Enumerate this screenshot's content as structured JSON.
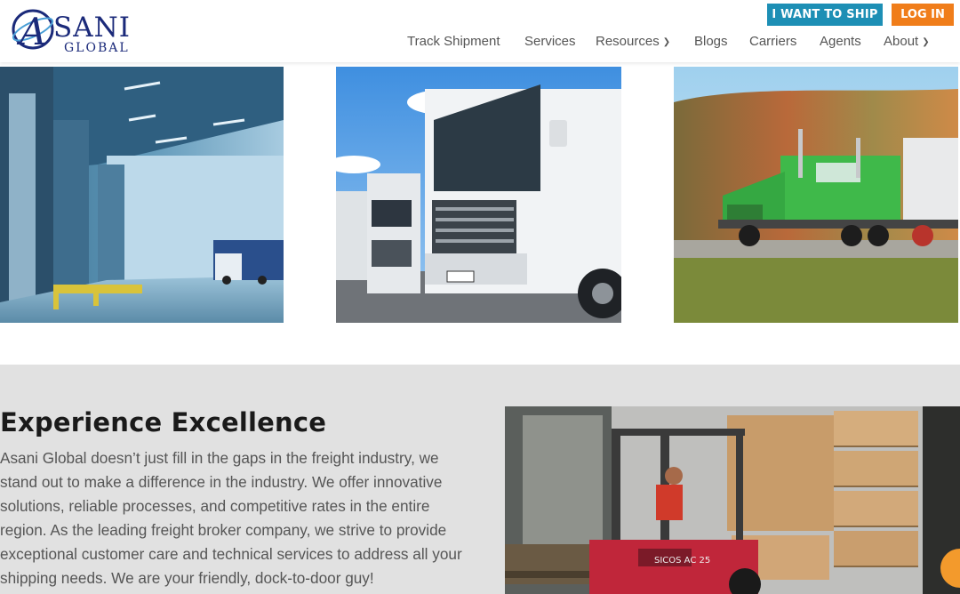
{
  "logo": {
    "text": "SANI",
    "mark_letter": "A",
    "subtitle": "GLOBAL"
  },
  "header": {
    "ship_button": "I WANT TO SHIP",
    "login_button": "LOG IN",
    "colors": {
      "ship": "#1d8fb5",
      "login": "#f07d1a",
      "logo": "#1b2a7a"
    }
  },
  "nav": {
    "items": [
      {
        "label": "Track Shipment",
        "dropdown": false
      },
      {
        "label": "Services",
        "dropdown": false
      },
      {
        "label": "Resources",
        "dropdown": true
      },
      {
        "label": "Blogs",
        "dropdown": false
      },
      {
        "label": "Carriers",
        "dropdown": false
      },
      {
        "label": "Agents",
        "dropdown": false
      },
      {
        "label": "About",
        "dropdown": true
      }
    ],
    "chevron_icon": "chevron-down-icon"
  },
  "photos": [
    {
      "subject": "warehouse loading dock"
    },
    {
      "subject": "row of white trucks"
    },
    {
      "subject": "green semi truck on road"
    }
  ],
  "section": {
    "title": "Experience Excellence",
    "body": "Asani Global doesn’t just fill in the gaps in the freight industry, we stand out to make a difference in the industry. We offer innovative solutions, reliable processes, and competitive rates in the entire region. As the leading freight broker company, we strive to provide exceptional customer care and technical services to address all your shipping needs. We are your friendly, dock-to-door guy!",
    "image": "forklift loading pallets",
    "forklift_label": "SICOS AC 25"
  },
  "chat": {
    "icon": "chat-icon",
    "color": "#f39a2c"
  }
}
